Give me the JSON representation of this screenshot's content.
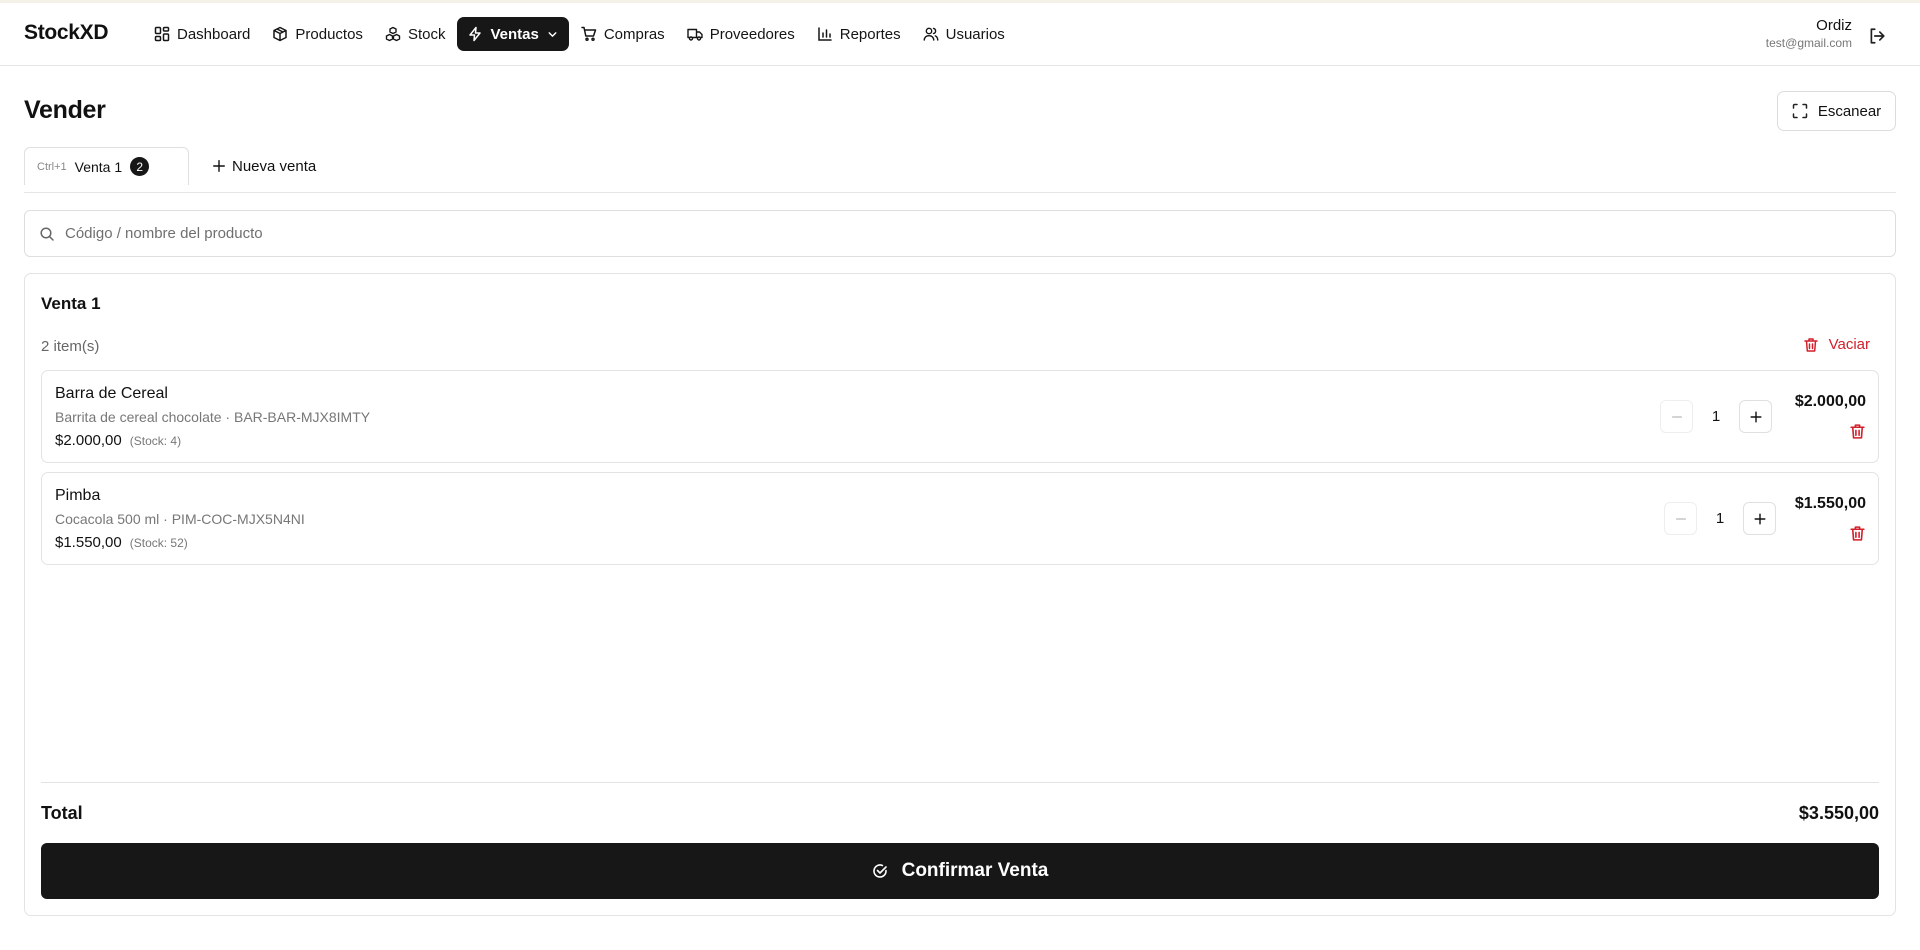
{
  "brand": "StockXD",
  "nav": [
    {
      "label": "Dashboard",
      "icon": "dashboard-icon"
    },
    {
      "label": "Productos",
      "icon": "box-icon"
    },
    {
      "label": "Stock",
      "icon": "boxes-icon"
    },
    {
      "label": "Ventas",
      "icon": "zap-icon",
      "active": true
    },
    {
      "label": "Compras",
      "icon": "cart-icon"
    },
    {
      "label": "Proveedores",
      "icon": "truck-icon"
    },
    {
      "label": "Reportes",
      "icon": "bar-chart-icon"
    },
    {
      "label": "Usuarios",
      "icon": "users-icon"
    }
  ],
  "user": {
    "name": "Ordiz",
    "email": "test@gmail.com"
  },
  "page": {
    "title": "Vender",
    "scan_label": "Escanear"
  },
  "tabs": [
    {
      "shortcut": "Ctrl+1",
      "label": "Venta 1",
      "badge": "2"
    }
  ],
  "new_tab_label": "Nueva venta",
  "search": {
    "placeholder": "Código / nombre del producto",
    "value": ""
  },
  "sale": {
    "title": "Venta 1",
    "item_count": "2 item(s)",
    "clear_label": "Vaciar",
    "items": [
      {
        "name": "Barra de Cereal",
        "description": "Barrita de cereal chocolate · BAR-BAR-MJX8IMTY",
        "price": "$2.000,00",
        "stock": "(Stock: 4)",
        "qty": "1",
        "total": "$2.000,00"
      },
      {
        "name": "Pimba",
        "description": "Cocacola 500 ml · PIM-COC-MJX5N4NI",
        "price": "$1.550,00",
        "stock": "(Stock: 52)",
        "qty": "1",
        "total": "$1.550,00"
      }
    ],
    "total_label": "Total",
    "total_value": "$3.550,00",
    "confirm_label": "Confirmar Venta"
  },
  "colors": {
    "primary": "#171717",
    "danger": "#d21f2a",
    "border": "#e3e3e3"
  }
}
